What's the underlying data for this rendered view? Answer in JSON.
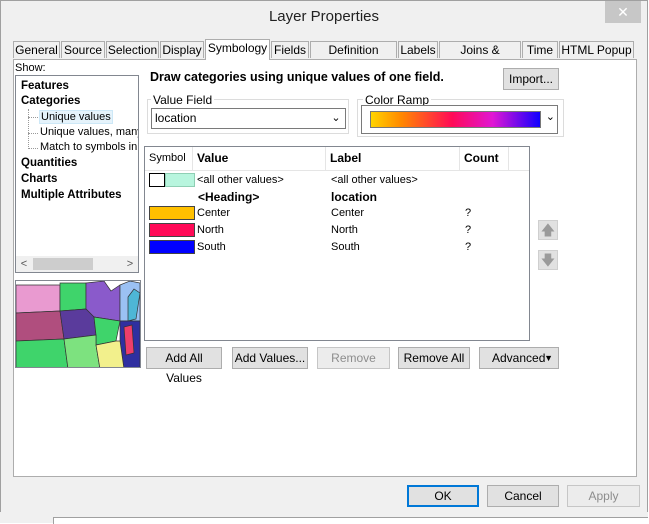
{
  "window": {
    "title": "Layer Properties",
    "close_glyph": "✕"
  },
  "tabs": [
    {
      "label": "General"
    },
    {
      "label": "Source"
    },
    {
      "label": "Selection"
    },
    {
      "label": "Display"
    },
    {
      "label": "Symbology"
    },
    {
      "label": "Fields"
    },
    {
      "label": "Definition Query"
    },
    {
      "label": "Labels"
    },
    {
      "label": "Joins & Relates"
    },
    {
      "label": "Time"
    },
    {
      "label": "HTML Popup"
    }
  ],
  "active_tab": "Symbology",
  "show": {
    "label": "Show:",
    "items": [
      {
        "label": "Features"
      },
      {
        "label": "Categories"
      },
      {
        "label": "Unique values"
      },
      {
        "label": "Unique values, many"
      },
      {
        "label": "Match to symbols in a"
      },
      {
        "label": "Quantities"
      },
      {
        "label": "Charts"
      },
      {
        "label": "Multiple Attributes"
      }
    ],
    "selected": "Unique values"
  },
  "description": "Draw categories using unique values of one field.",
  "import_button": "Import...",
  "value_field": {
    "label": "Value Field",
    "value": "location"
  },
  "color_ramp": {
    "label": "Color Ramp"
  },
  "table": {
    "headers": [
      "Symbol",
      "Value",
      "Label",
      "Count"
    ],
    "rows": [
      {
        "value": "<all other values>",
        "label": "<all other values>",
        "count": "",
        "color": "#b8f5de",
        "bold": false
      },
      {
        "value": "<Heading>",
        "label": "location",
        "count": "",
        "color": "",
        "bold": true
      },
      {
        "value": "Center",
        "label": "Center",
        "count": "?",
        "color": "#ffc000",
        "bold": false
      },
      {
        "value": "North",
        "label": "North",
        "count": "?",
        "color": "#ff0a57",
        "bold": false
      },
      {
        "value": "South",
        "label": "South",
        "count": "?",
        "color": "#0000ff",
        "bold": false
      }
    ]
  },
  "actions": {
    "add_all": "Add All Values",
    "add_values": "Add Values...",
    "remove": "Remove",
    "remove_all": "Remove All",
    "advanced": "Advanced"
  },
  "dialog": {
    "ok": "OK",
    "cancel": "Cancel",
    "apply": "Apply"
  }
}
